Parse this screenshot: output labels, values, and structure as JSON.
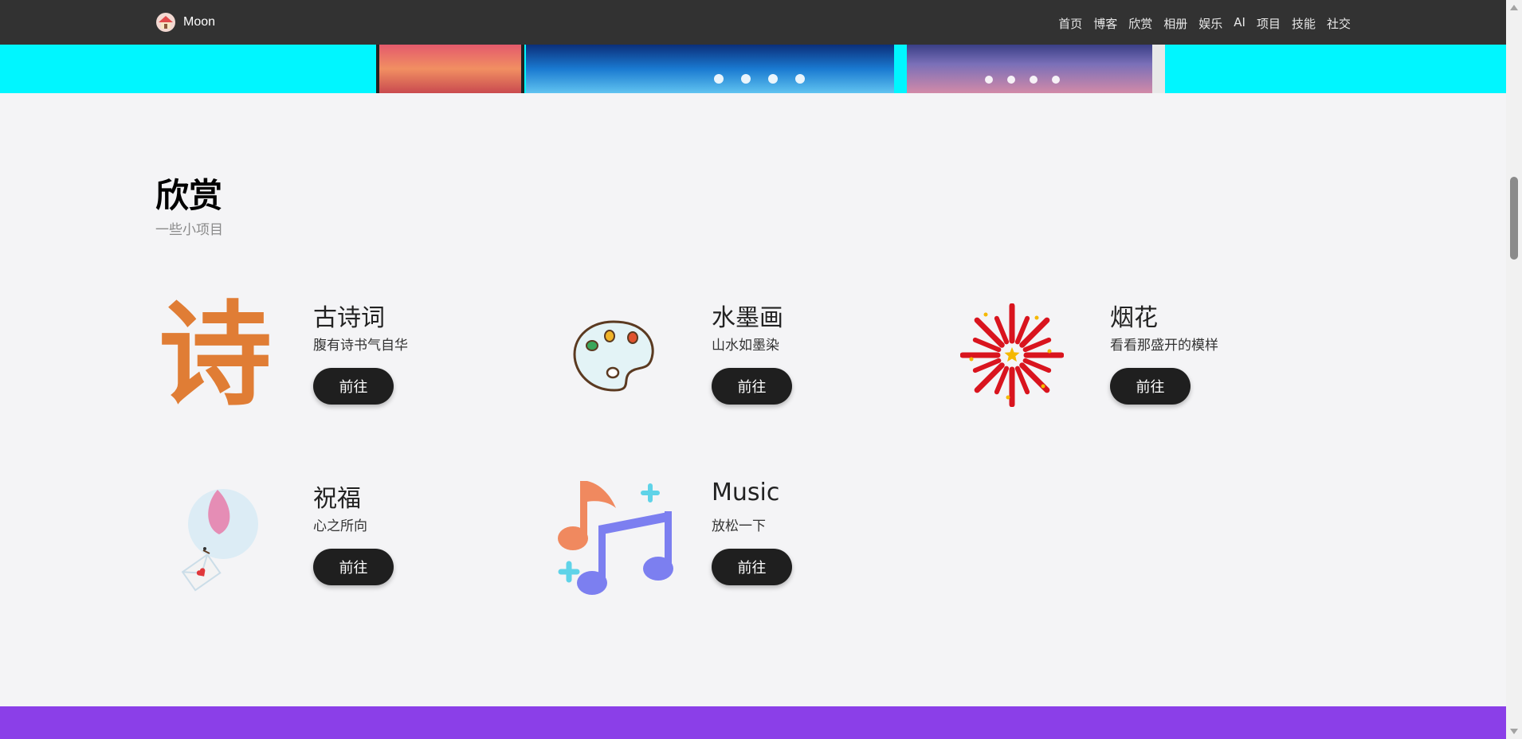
{
  "brand": {
    "name": "Moon"
  },
  "nav": [
    "首页",
    "博客",
    "欣赏",
    "相册",
    "娱乐",
    "AI",
    "项目",
    "技能",
    "社交"
  ],
  "section": {
    "title": "欣赏",
    "subtitle": "一些小项目"
  },
  "cards": [
    {
      "title": "古诗词",
      "desc": "腹有诗书气自华",
      "button": "前往",
      "icon": "poem-char-icon"
    },
    {
      "title": "水墨画",
      "desc": "山水如墨染",
      "button": "前往",
      "icon": "palette-icon"
    },
    {
      "title": "烟花",
      "desc": "看看那盛开的模样",
      "button": "前往",
      "icon": "firework-icon"
    },
    {
      "title": "祝福",
      "desc": "心之所向",
      "button": "前往",
      "icon": "dove-letter-icon"
    },
    {
      "title": "Music",
      "desc": "放松一下",
      "button": "前往",
      "icon": "music-notes-icon"
    }
  ],
  "icon_glyphs": {
    "poem": "诗"
  },
  "colors": {
    "topbar": "#323232",
    "banner": "#00f6ff",
    "page_bg": "#f4f4f6",
    "button": "#1f1f1f",
    "footer_strip": "#8b3fe8",
    "poem_orange": "#e07d35"
  }
}
